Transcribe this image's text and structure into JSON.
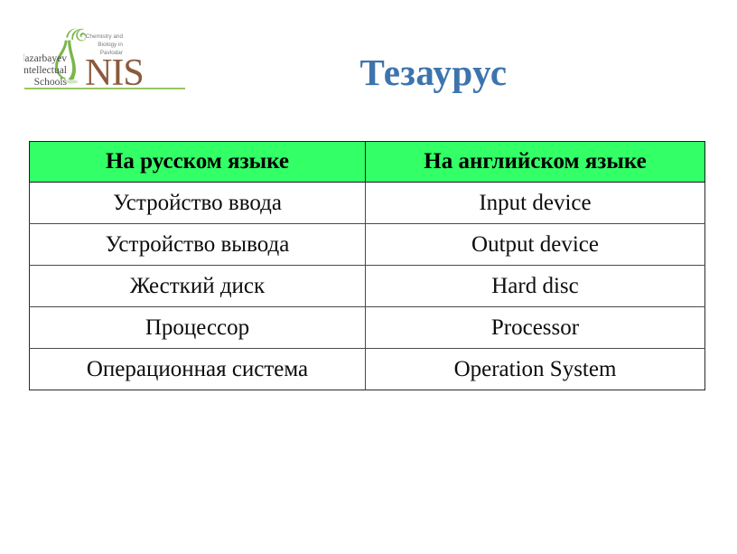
{
  "slide": {
    "title": "Тезаурус"
  },
  "logo": {
    "school_name_line1": "Nazarbayev",
    "school_name_line2": "Intellectual",
    "school_name_line3": "Schools",
    "tagline_line1": "Chemistry and",
    "tagline_line2": "Biology in",
    "tagline_line3": "Pavlodar",
    "acronym": "NIS",
    "colors": {
      "green": "#7ab648",
      "brown": "#8b5a3c",
      "text_gray": "#4a4a4a"
    }
  },
  "table": {
    "columns": [
      "На русском языке",
      "На английском языке"
    ],
    "rows": [
      {
        "ru": "Устройство ввода",
        "en": "Input device"
      },
      {
        "ru": "Устройство вывода",
        "en": "Output device"
      },
      {
        "ru": "Жесткий диск",
        "en": "Hard disc"
      },
      {
        "ru": "Процессор",
        "en": "Processor"
      },
      {
        "ru": "Операционная система",
        "en": "Operation System"
      }
    ],
    "header_background": "#33ff66",
    "border_color": "#2b2b2b"
  },
  "theme": {
    "title_color": "#3d74ad",
    "background": "#ffffff"
  }
}
